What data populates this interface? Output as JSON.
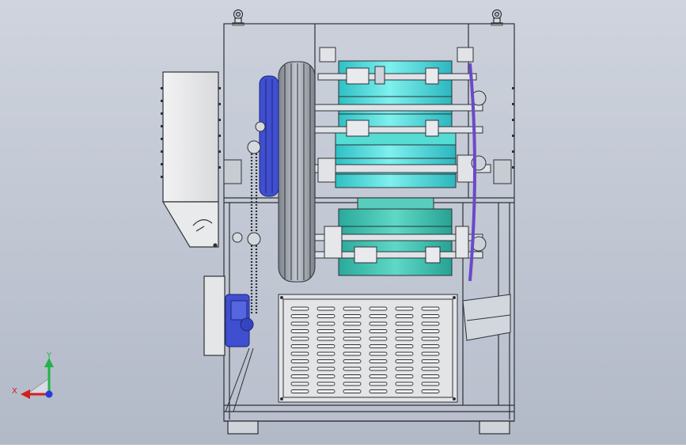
{
  "viewport": {
    "background_top": "#cfd4de",
    "background_bottom": "#b2b9c7"
  },
  "triad": {
    "x_label": "X",
    "y_label": "Y",
    "x_color": "#d21f1f",
    "y_color": "#21b34a",
    "z_color": "#2a3ad8"
  },
  "colors": {
    "frame_line": "#2e3136",
    "cyan_rotor": "#44d8da",
    "teal_rotor": "#3fc4b0",
    "blue_motor": "#3f4fd0",
    "purple_disc": "#6a4ac8",
    "panel_grey": "#e3e4e6",
    "pulley_grey": "#9aa0a8"
  }
}
